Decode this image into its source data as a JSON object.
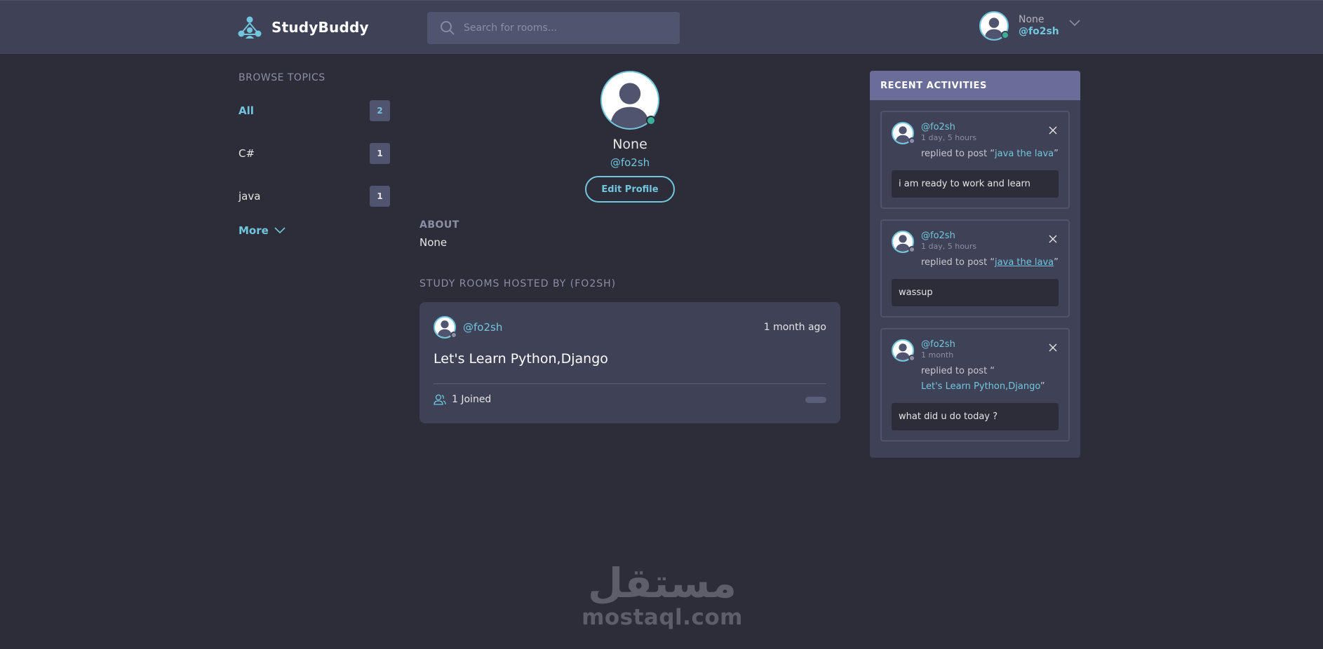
{
  "app": {
    "name": "StudyBuddy"
  },
  "header": {
    "search_placeholder": "Search for rooms...",
    "user": {
      "name": "None",
      "handle": "@fo2sh"
    }
  },
  "sidebar": {
    "title": "BROWSE TOPICS",
    "topics": [
      {
        "label": "All",
        "count": "2"
      },
      {
        "label": "C#",
        "count": "1"
      },
      {
        "label": "java",
        "count": "1"
      }
    ],
    "more_label": "More"
  },
  "profile": {
    "name": "None",
    "handle": "@fo2sh",
    "edit_label": "Edit Profile",
    "about_title": "ABOUT",
    "about_text": "None",
    "rooms_title": "STUDY ROOMS HOSTED BY (FO2SH)"
  },
  "rooms": [
    {
      "host": "@fo2sh",
      "time": "1 month ago",
      "title": "Let's Learn Python,Django",
      "joined": "1 Joined"
    }
  ],
  "activities": {
    "title": "RECENT ACTIVITIES",
    "items": [
      {
        "user": "@fo2sh",
        "time": "1 day, 5 hours",
        "action_prefix": "replied to post “",
        "post": "java the lava",
        "action_suffix": "”",
        "body": "i am ready to work and learn"
      },
      {
        "user": "@fo2sh",
        "time": "1 day, 5 hours",
        "action_prefix": "replied to post “",
        "post": "java the lava",
        "action_suffix": "”",
        "body": "wassup"
      },
      {
        "user": "@fo2sh",
        "time": "1 month",
        "action_prefix": "replied to post “",
        "post": "Let's Learn Python,Django",
        "action_suffix": "”",
        "body": "what did u do today ?"
      }
    ]
  },
  "watermark": {
    "arabic": "مستقل",
    "latin": "mostaql.com"
  },
  "colors": {
    "background": "#2d2d39",
    "header": "#3f4156",
    "accent": "#71c6dd",
    "activities_header": "#696d97",
    "online": "#3ab09a"
  }
}
